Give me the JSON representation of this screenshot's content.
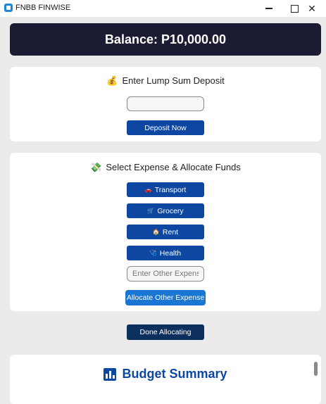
{
  "window": {
    "title": "FNBB FINWISE",
    "minimize_icon": "minimize-icon",
    "maximize_icon": "maximize-icon",
    "close_label": "✕"
  },
  "balance": {
    "text": "Balance: P10,000.00"
  },
  "deposit": {
    "icon": "💰",
    "heading": "Enter Lump Sum Deposit",
    "input_value": "",
    "button_label": "Deposit Now"
  },
  "expenses": {
    "icon": "💸",
    "heading": "Select Expense & Allocate Funds",
    "items": [
      {
        "icon": "🚗",
        "label": "Transport"
      },
      {
        "icon": "🛒",
        "label": "Grocery"
      },
      {
        "icon": "🏠",
        "label": "Rent"
      },
      {
        "icon": "🩺",
        "label": "Health"
      }
    ],
    "other_placeholder": "Enter Other Expense",
    "allocate_other_label": "Allocate Other Expense"
  },
  "done_button_label": "Done Allocating",
  "summary": {
    "title": "Budget Summary"
  },
  "colors": {
    "primary_button": "#0d47a1",
    "light_button": "#1976d2",
    "dark_button": "#0d2f5e",
    "balance_bg": "#1b1c33"
  }
}
